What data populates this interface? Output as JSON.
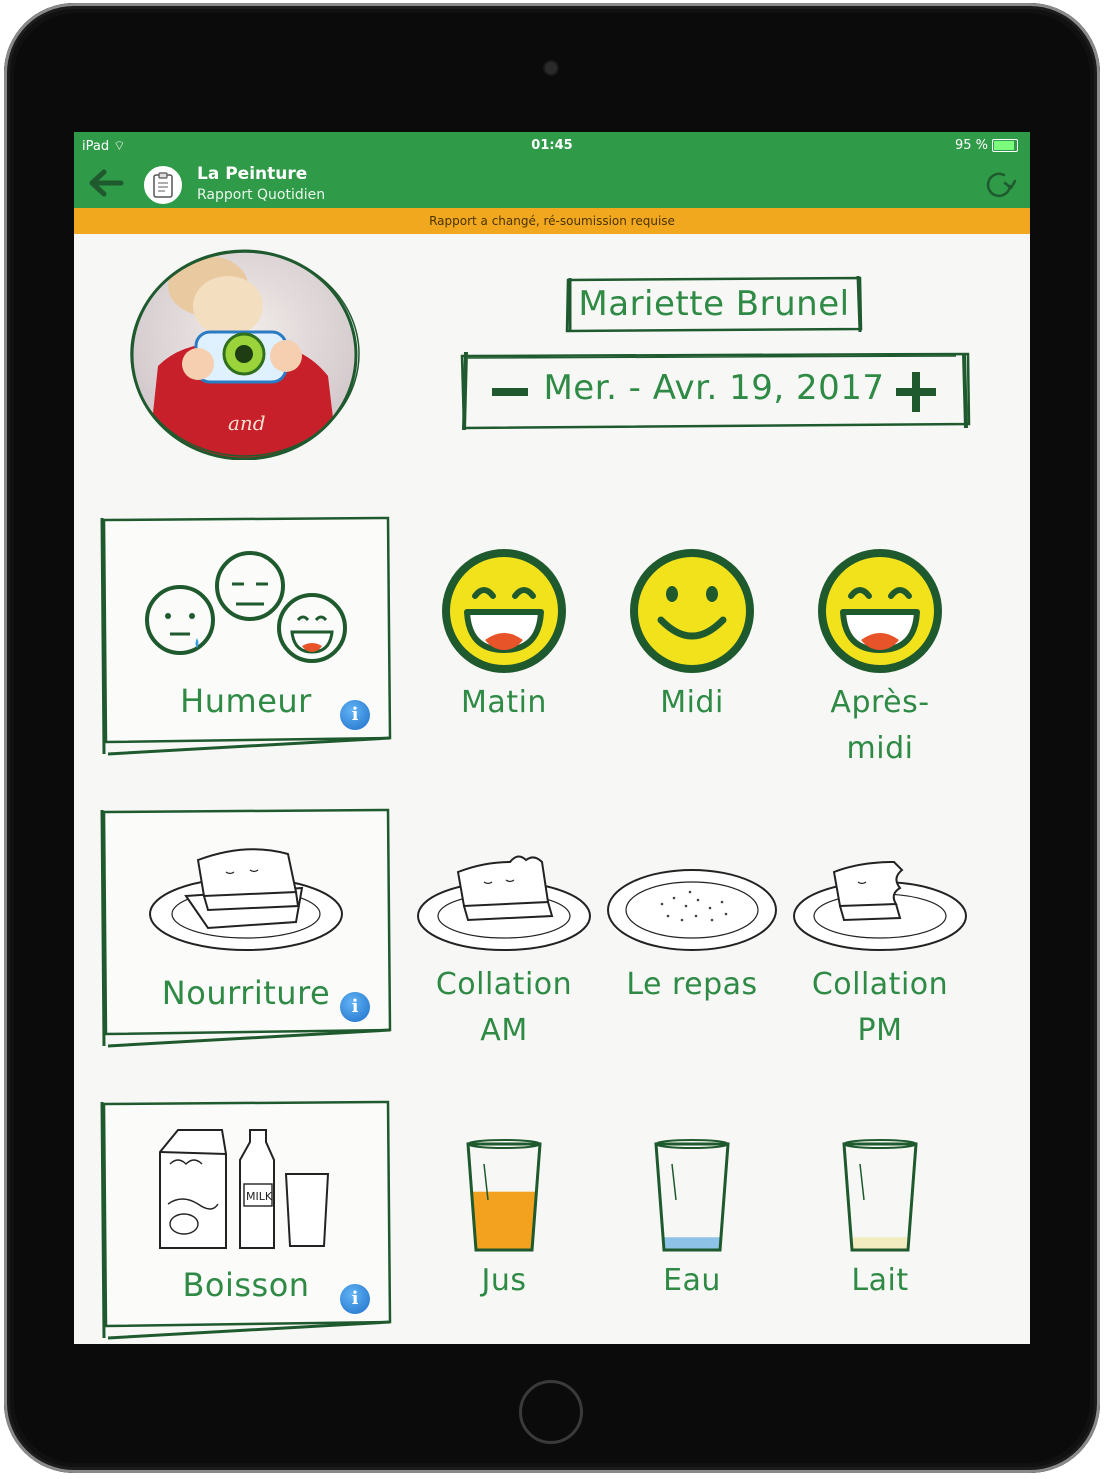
{
  "device": {
    "carrier": "iPad",
    "time": "01:45",
    "battery": "95 %",
    "battery_level": 0.95
  },
  "header": {
    "title": "La Peinture",
    "subtitle": "Rapport Quotidien"
  },
  "warning": "Rapport a changé, ré-soumission requise",
  "child": {
    "name": "Mariette Brunel",
    "date": "Mer. - Avr. 19, 2017"
  },
  "categories": {
    "humeur": {
      "label": "Humeur",
      "items": [
        {
          "label": "Matin",
          "face": "big-grin"
        },
        {
          "label": "Midi",
          "face": "smile"
        },
        {
          "label": "Après-midi",
          "face": "big-grin"
        }
      ]
    },
    "nourriture": {
      "label": "Nourriture",
      "items": [
        {
          "label": "Collation AM",
          "plate": "sandwich-bitten"
        },
        {
          "label": "Le repas",
          "plate": "empty-crumbs"
        },
        {
          "label": "Collation PM",
          "plate": "sandwich-bitten"
        }
      ]
    },
    "boisson": {
      "label": "Boisson",
      "items": [
        {
          "label": "Jus",
          "liquid_color": "#f3a21f",
          "fill_level": 0.55
        },
        {
          "label": "Eau",
          "liquid_color": "#8ec2e6",
          "fill_level": 0.12
        },
        {
          "label": "Lait",
          "liquid_color": "#f3ecc0",
          "fill_level": 0.12
        }
      ]
    }
  },
  "colors": {
    "brand_green": "#2f9a48",
    "text_green": "#2e8a45",
    "warning_orange": "#f2a81e",
    "smiley_yellow": "#f2e21c",
    "frame_green": "#1f5a2e"
  }
}
